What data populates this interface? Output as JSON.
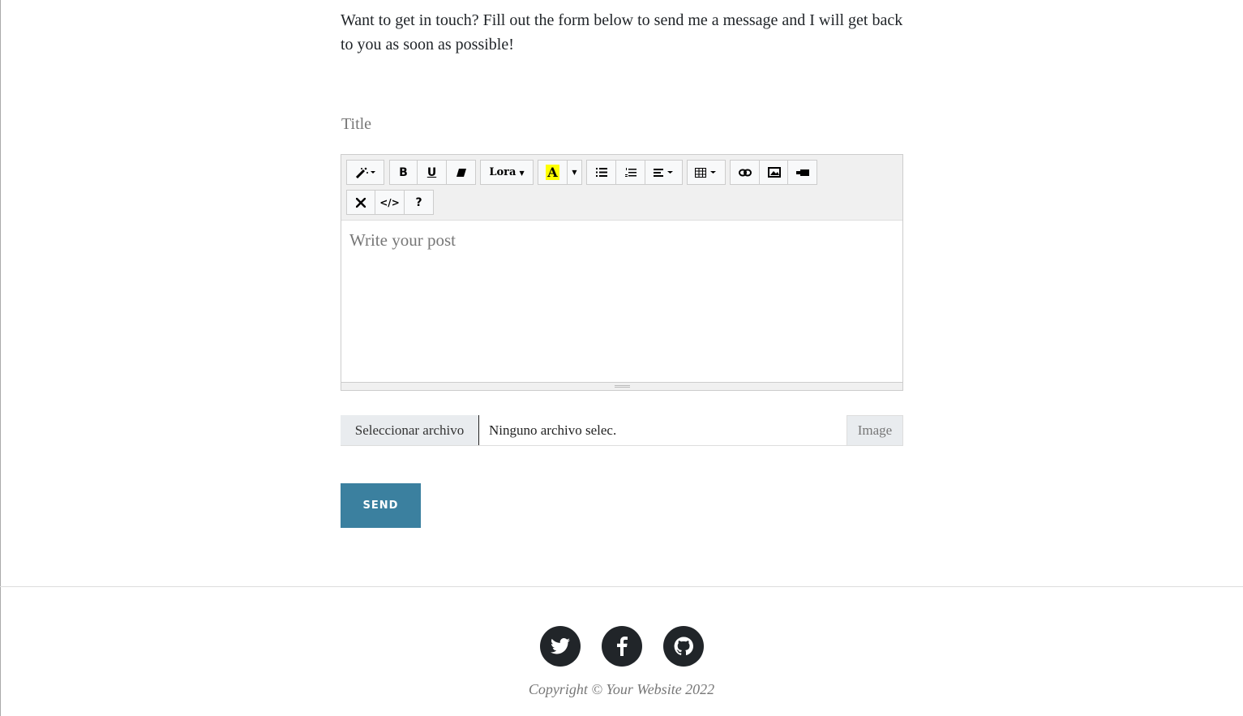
{
  "intro": "Want to get in touch? Fill out the form below to send me a message and I will get back to you as soon as possible!",
  "title_label": "Title",
  "toolbar": {
    "bold": "B",
    "underline": "U",
    "font": "Lora",
    "color": "A",
    "code": "</>",
    "help": "?"
  },
  "editor": {
    "placeholder": "Write your post"
  },
  "file": {
    "button": "Seleccionar archivo",
    "status": "Ninguno archivo selec.",
    "label": "Image"
  },
  "send": "SEND",
  "footer": {
    "copyright": "Copyright © Your Website 2022"
  }
}
